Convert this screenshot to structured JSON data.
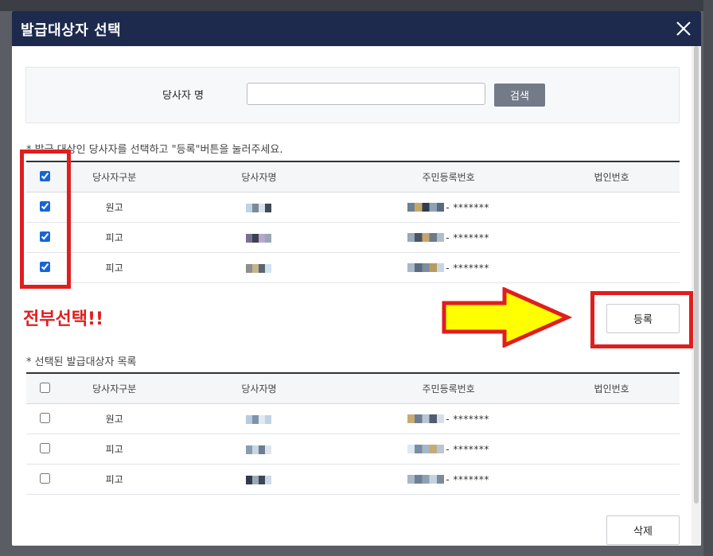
{
  "modal": {
    "title": "발급대상자 선택"
  },
  "search": {
    "label": "당사자 명",
    "value": "",
    "placeholder": "",
    "button_label": "검색"
  },
  "instruction": "* 발급 대상인 당사자를 선택하고 \"등록\"버튼을 눌러주세요.",
  "columns": [
    "당사자구분",
    "당사자명",
    "주민등록번호",
    "법인번호"
  ],
  "party_table": {
    "header_checked": true,
    "rows": [
      {
        "checked": true,
        "type": "원고",
        "name": "",
        "rrn_suffix": "- *******",
        "corp_no": ""
      },
      {
        "checked": true,
        "type": "피고",
        "name": "",
        "rrn_suffix": "- *******",
        "corp_no": ""
      },
      {
        "checked": true,
        "type": "피고",
        "name": "",
        "rrn_suffix": "- *******",
        "corp_no": ""
      }
    ]
  },
  "annotation": {
    "select_all_text": "전부선택!!",
    "highlight_color": "#e01e1e",
    "arrow_color": "#ffff00"
  },
  "register_button_label": "등록",
  "selected_list_title": "* 선택된 발급대상자 목록",
  "selected_table": {
    "header_checked": false,
    "rows": [
      {
        "checked": false,
        "type": "원고",
        "name": "",
        "rrn_suffix": "- *******",
        "corp_no": ""
      },
      {
        "checked": false,
        "type": "피고",
        "name": "",
        "rrn_suffix": "- *******",
        "corp_no": ""
      },
      {
        "checked": false,
        "type": "피고",
        "name": "",
        "rrn_suffix": "- *******",
        "corp_no": ""
      }
    ]
  },
  "delete_button_label": "삭제",
  "colors": {
    "header_bg": "#1d2a4e",
    "search_button_bg": "#737b88",
    "checkbox_accent": "#1565d8"
  }
}
